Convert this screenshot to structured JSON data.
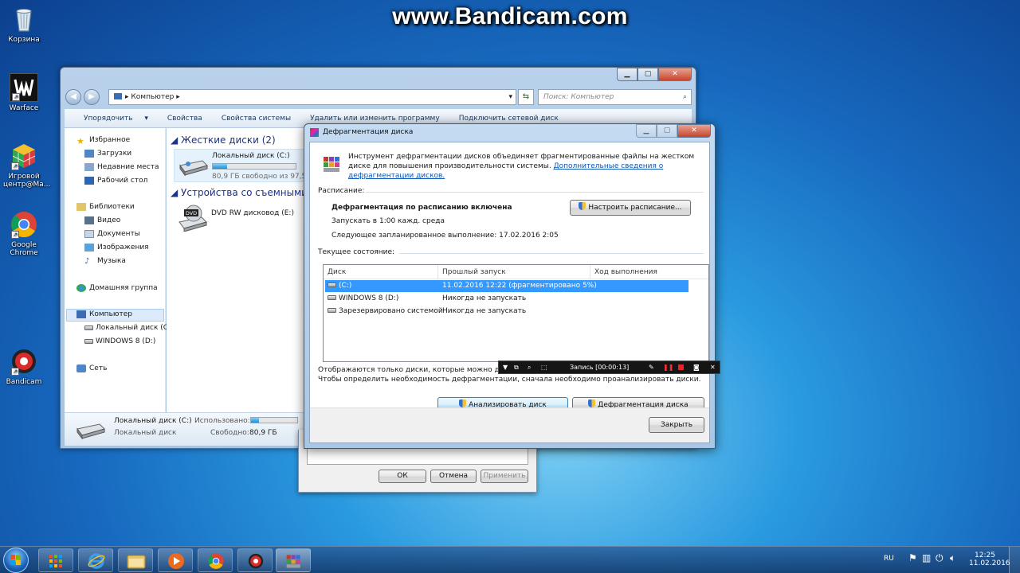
{
  "watermark": "www.Bandicam.com",
  "desktop": {
    "icons": [
      {
        "label": "Корзина"
      },
      {
        "label": "Warface"
      },
      {
        "label": "Игровой центр@Ma..."
      },
      {
        "label": "Google Chrome"
      },
      {
        "label": "Bandicam"
      }
    ]
  },
  "explorer": {
    "address": "Компьютер",
    "search_placeholder": "Поиск: Компьютер",
    "toolbar": [
      "Упорядочить",
      "Свойства",
      "Свойства системы",
      "Удалить или изменить программу",
      "Подключить сетевой диск"
    ],
    "nav": {
      "favorites": "Избранное",
      "downloads": "Загрузки",
      "recent": "Недавние места",
      "desktop": "Рабочий стол",
      "libraries": "Библиотеки",
      "video": "Видео",
      "documents": "Документы",
      "images": "Изображения",
      "music": "Музыка",
      "homegroup": "Домашняя группа",
      "computer": "Компьютер",
      "local_disk": "Локальный диск (С",
      "windows8": "WINDOWS 8 (D:)",
      "network": "Сеть"
    },
    "groups": {
      "hdd": "Жесткие диски (2)",
      "removable": "Устройства со съемными н"
    },
    "drive_c": {
      "name": "Локальный диск (C:)",
      "free": "80,9 ГБ свободно из 97,5",
      "used_fraction": 0.17
    },
    "dvd": {
      "name": "DVD RW дисковод (E:)",
      "badge": "DVD"
    },
    "details": {
      "name": "Локальный диск (C:)",
      "type": "Локальный диск",
      "used_label": "Использовано:",
      "free_label": "Свободно:",
      "free_value": "80,9 ГБ",
      "used_fraction": 0.17
    }
  },
  "props_dialog": {
    "ok": "ОК",
    "cancel": "Отмена",
    "apply": "Применить"
  },
  "defrag": {
    "title": "Дефрагментация диска",
    "intro": "Инструмент дефрагментации дисков объединяет фрагментированные файлы на жестком диске для повышения производительности системы.",
    "intro_link": "Дополнительные сведения о дефрагментации дисков.",
    "schedule_label": "Расписание:",
    "schedule_on": "Дефрагментация по расписанию включена",
    "schedule_run": "Запускать в 1:00 кажд. среда",
    "schedule_next": "Следующее запланированное выполнение: 17.02.2016 2:05",
    "configure_btn": "Настроить расписание...",
    "status_label": "Текущее состояние:",
    "columns": [
      "Диск",
      "Прошлый запуск",
      "Ход выполнения"
    ],
    "rows": [
      {
        "disk": "(C:)",
        "last": "11.02.2016 12:22 (фрагментировано 5%)",
        "progress": ""
      },
      {
        "disk": "WINDOWS 8 (D:)",
        "last": "Никогда не запускать",
        "progress": ""
      },
      {
        "disk": "Зарезервировано системой",
        "last": "Никогда не запускать",
        "progress": ""
      }
    ],
    "note1": "Отображаются только диски, которые можно дефр",
    "note2": "Чтобы определить необходимость  дефрагментации, сначала необходимо проанализировать диски.",
    "analyze_btn": "Анализировать диск",
    "defrag_btn": "Дефрагментация диска",
    "close_btn": "Закрыть"
  },
  "bandicam": {
    "recording": "Запись [00:00:13]"
  },
  "taskbar": {
    "lang": "RU",
    "time": "12:25",
    "date": "11.02.2016"
  }
}
